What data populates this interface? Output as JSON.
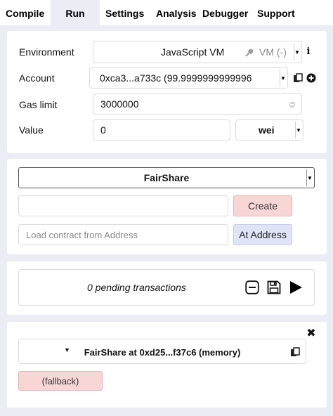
{
  "tabs": [
    {
      "label": "Compile"
    },
    {
      "label": "Run"
    },
    {
      "label": "Settings"
    },
    {
      "label": "Analysis"
    },
    {
      "label": "Debugger"
    },
    {
      "label": "Support"
    }
  ],
  "active_tab": "Run",
  "settings": {
    "environment": {
      "label": "Environment",
      "value": "JavaScript VM",
      "badge": "VM (-)",
      "info": "i"
    },
    "account": {
      "label": "Account",
      "value": "0xca3...a733c (99.9999999999996"
    },
    "gas_limit": {
      "label": "Gas limit",
      "value": "3000000"
    },
    "value": {
      "label": "Value",
      "amount": "0",
      "unit": "wei"
    }
  },
  "contract": {
    "selected": "FairShare",
    "create_args_placeholder": "",
    "create_label": "Create",
    "address_placeholder": "Load contract from Address",
    "at_address_label": "At Address"
  },
  "transactions": {
    "pending_text": "0 pending transactions"
  },
  "instances": [
    {
      "title": "FairShare at 0xd25...f37c6 (memory)",
      "functions": [
        {
          "label": "(fallback)"
        }
      ]
    }
  ],
  "colors": {
    "background": "#ececf5",
    "action_red": "#f8d6d6",
    "action_blue": "#e0e4f7"
  }
}
